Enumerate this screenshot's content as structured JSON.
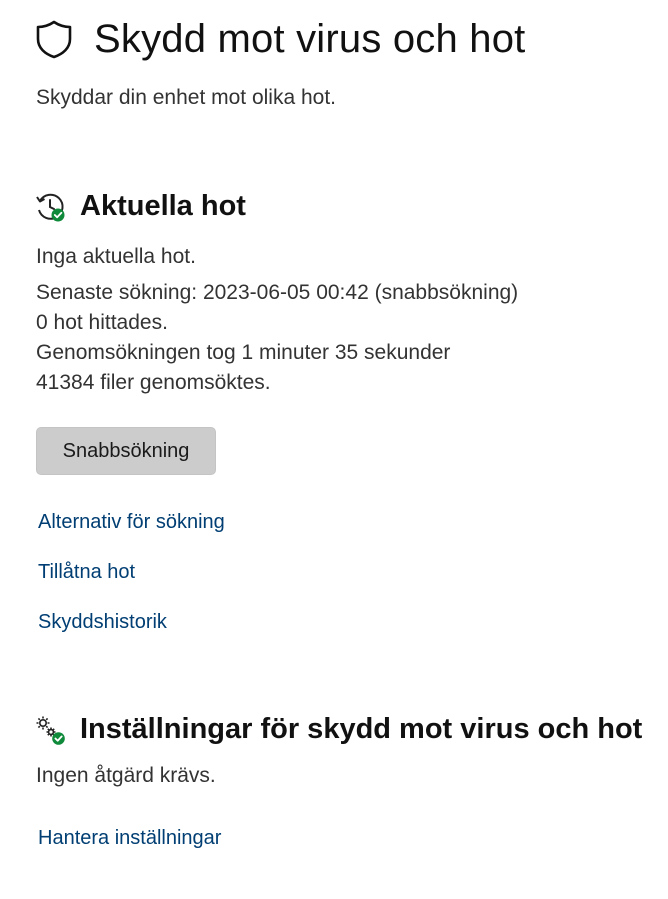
{
  "page": {
    "title": "Skydd mot virus och hot",
    "subtitle": "Skyddar din enhet mot olika hot."
  },
  "current_threats": {
    "title": "Aktuella hot",
    "status": "Inga aktuella hot.",
    "last_scan": "Senaste sökning: 2023-06-05 00:42 (snabbsökning)",
    "found": "0 hot hittades.",
    "duration": "Genomsökningen tog 1 minuter 35 sekunder",
    "files": "41384 filer genomsöktes.",
    "quick_scan_button": "Snabbsökning",
    "links": {
      "scan_options": "Alternativ för sökning",
      "allowed_threats": "Tillåtna hot",
      "protection_history": "Skyddshistorik"
    }
  },
  "settings": {
    "title": "Inställningar för skydd mot virus och hot",
    "status": "Ingen åtgärd krävs.",
    "manage_link": "Hantera inställningar"
  },
  "icons": {
    "header": "shield-icon",
    "threats": "history-check-icon",
    "settings": "gears-check-icon"
  },
  "colors": {
    "link": "#003e73",
    "status_ok": "#0f8a3a",
    "button_bg": "#cccccc"
  }
}
